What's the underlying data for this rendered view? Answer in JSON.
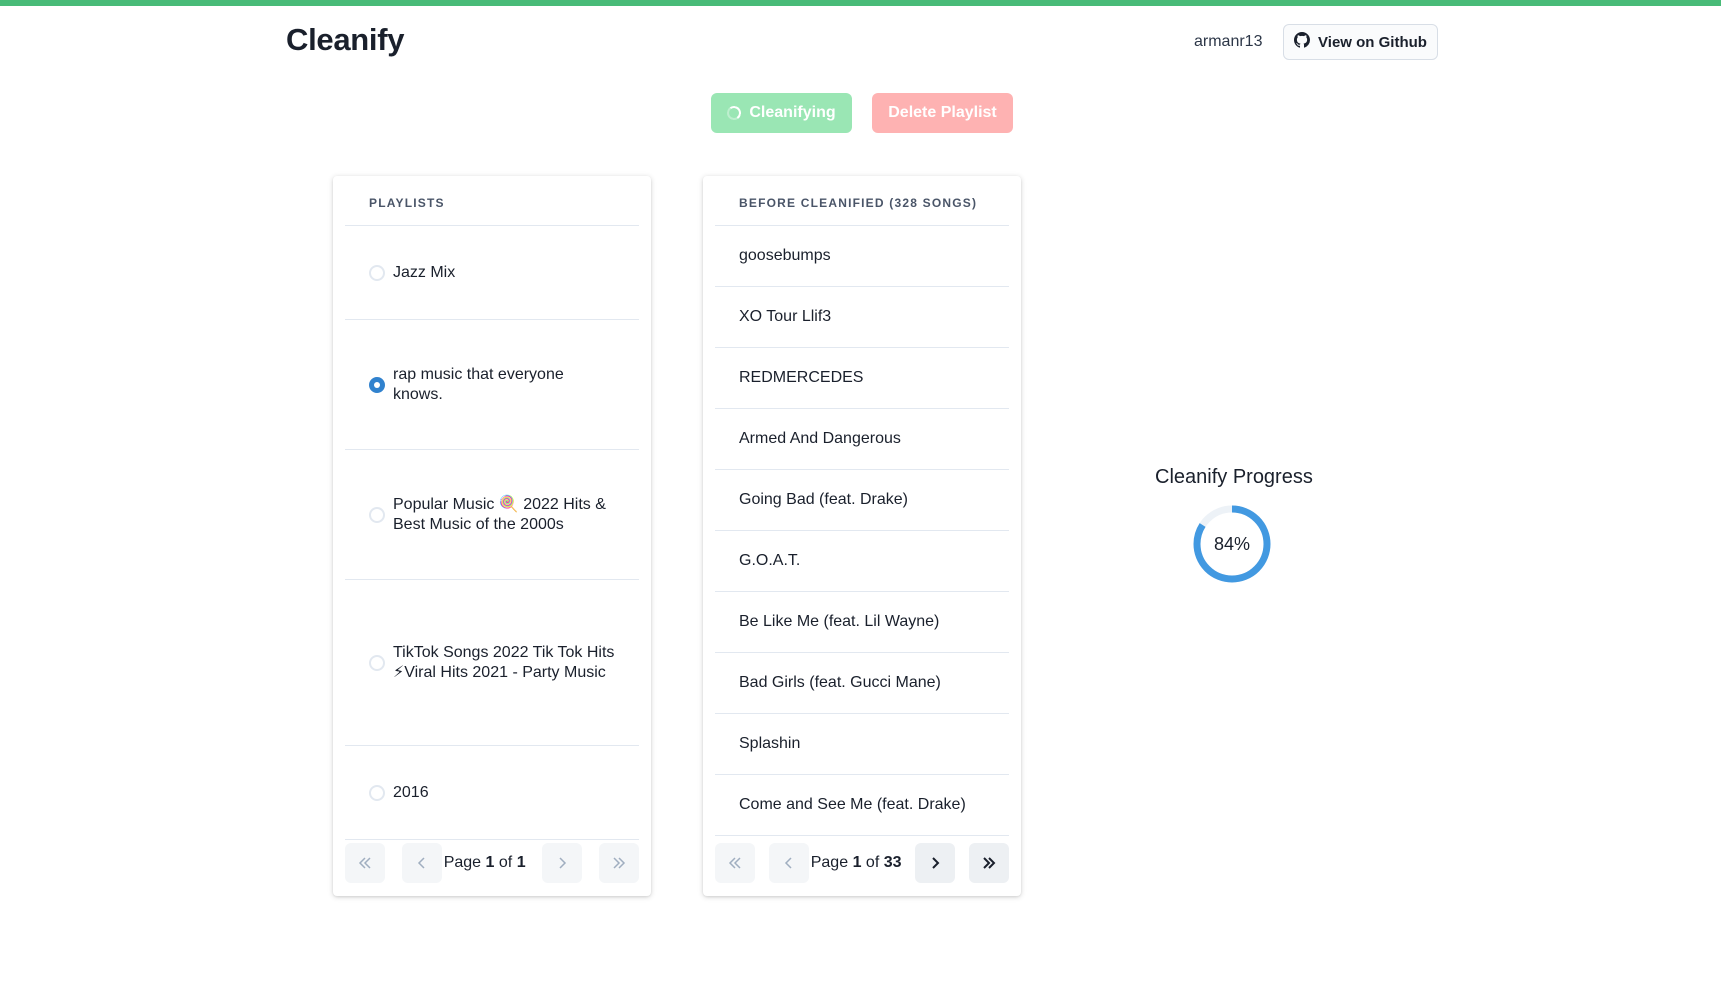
{
  "app": {
    "brand": "Cleanify",
    "accent_color": "#48bb78"
  },
  "header": {
    "username": "armanr13",
    "github_button_label": "View on Github",
    "github_icon": "github-icon"
  },
  "actions": {
    "cleanify_label": "Cleanifying",
    "cleanify_state": "loading",
    "delete_label": "Delete Playlist"
  },
  "playlists": {
    "header": "PLAYLISTS",
    "items": [
      {
        "label": "Jazz Mix",
        "selected": false
      },
      {
        "label": "rap music that everyone knows.",
        "selected": true
      },
      {
        "label": "Popular Music 🍭 2022 Hits & Best Music of the 2000s",
        "selected": false
      },
      {
        "label": "TikTok Songs 2022 Tik Tok Hits ⚡Viral Hits 2021 - Party Music",
        "selected": false
      },
      {
        "label": "2016",
        "selected": false
      }
    ],
    "pager": {
      "prefix": "Page",
      "current": "1",
      "of": "of",
      "total": "1"
    }
  },
  "songs": {
    "header": "BEFORE CLEANIFIED (328 SONGS)",
    "items": [
      "goosebumps",
      "XO Tour Llif3",
      "REDMERCEDES",
      "Armed And Dangerous",
      "Going Bad (feat. Drake)",
      "G.O.A.T.",
      "Be Like Me (feat. Lil Wayne)",
      "Bad Girls (feat. Gucci Mane)",
      "Splashin",
      "Come and See Me (feat. Drake)"
    ],
    "pager": {
      "prefix": "Page",
      "current": "1",
      "of": "of",
      "total": "33"
    }
  },
  "progress": {
    "title": "Cleanify Progress",
    "value": 84,
    "label": "84%",
    "color": "#4299e1",
    "track_color": "#edf2f7"
  }
}
